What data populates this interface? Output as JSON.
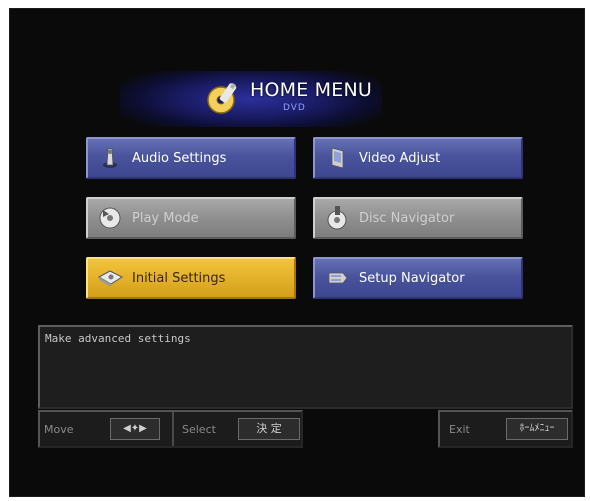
{
  "header": {
    "title": "HOME MENU",
    "subtitle": "DVD",
    "logo_icon": "disc-tool-icon"
  },
  "menu": {
    "audio_settings": {
      "label": "Audio Settings",
      "icon": "speaker-icon",
      "state": "normal"
    },
    "video_adjust": {
      "label": "Video Adjust",
      "icon": "tv-icon",
      "state": "normal"
    },
    "play_mode": {
      "label": "Play Mode",
      "icon": "play-disc-icon",
      "state": "disabled"
    },
    "disc_navigator": {
      "label": "Disc Navigator",
      "icon": "disc-navigator-icon",
      "state": "disabled"
    },
    "initial_settings": {
      "label": "Initial Settings",
      "icon": "disc-settings-icon",
      "state": "selected"
    },
    "setup_navigator": {
      "label": "Setup Navigator",
      "icon": "setup-icon",
      "state": "normal"
    }
  },
  "description": "Make advanced settings",
  "footer": {
    "move_label": "Move",
    "move_key": "◀✦▶",
    "select_label": "Select",
    "select_key": "決 定",
    "exit_label": "Exit",
    "exit_key": "ﾎｰﾑﾒﾆｭｰ"
  },
  "colors": {
    "button_blue": "#4a549c",
    "button_gray": "#8f8f8f",
    "button_selected": "#e4b22a",
    "header_glow": "#2c2f9a",
    "screen_bg": "#0a0a0a"
  }
}
